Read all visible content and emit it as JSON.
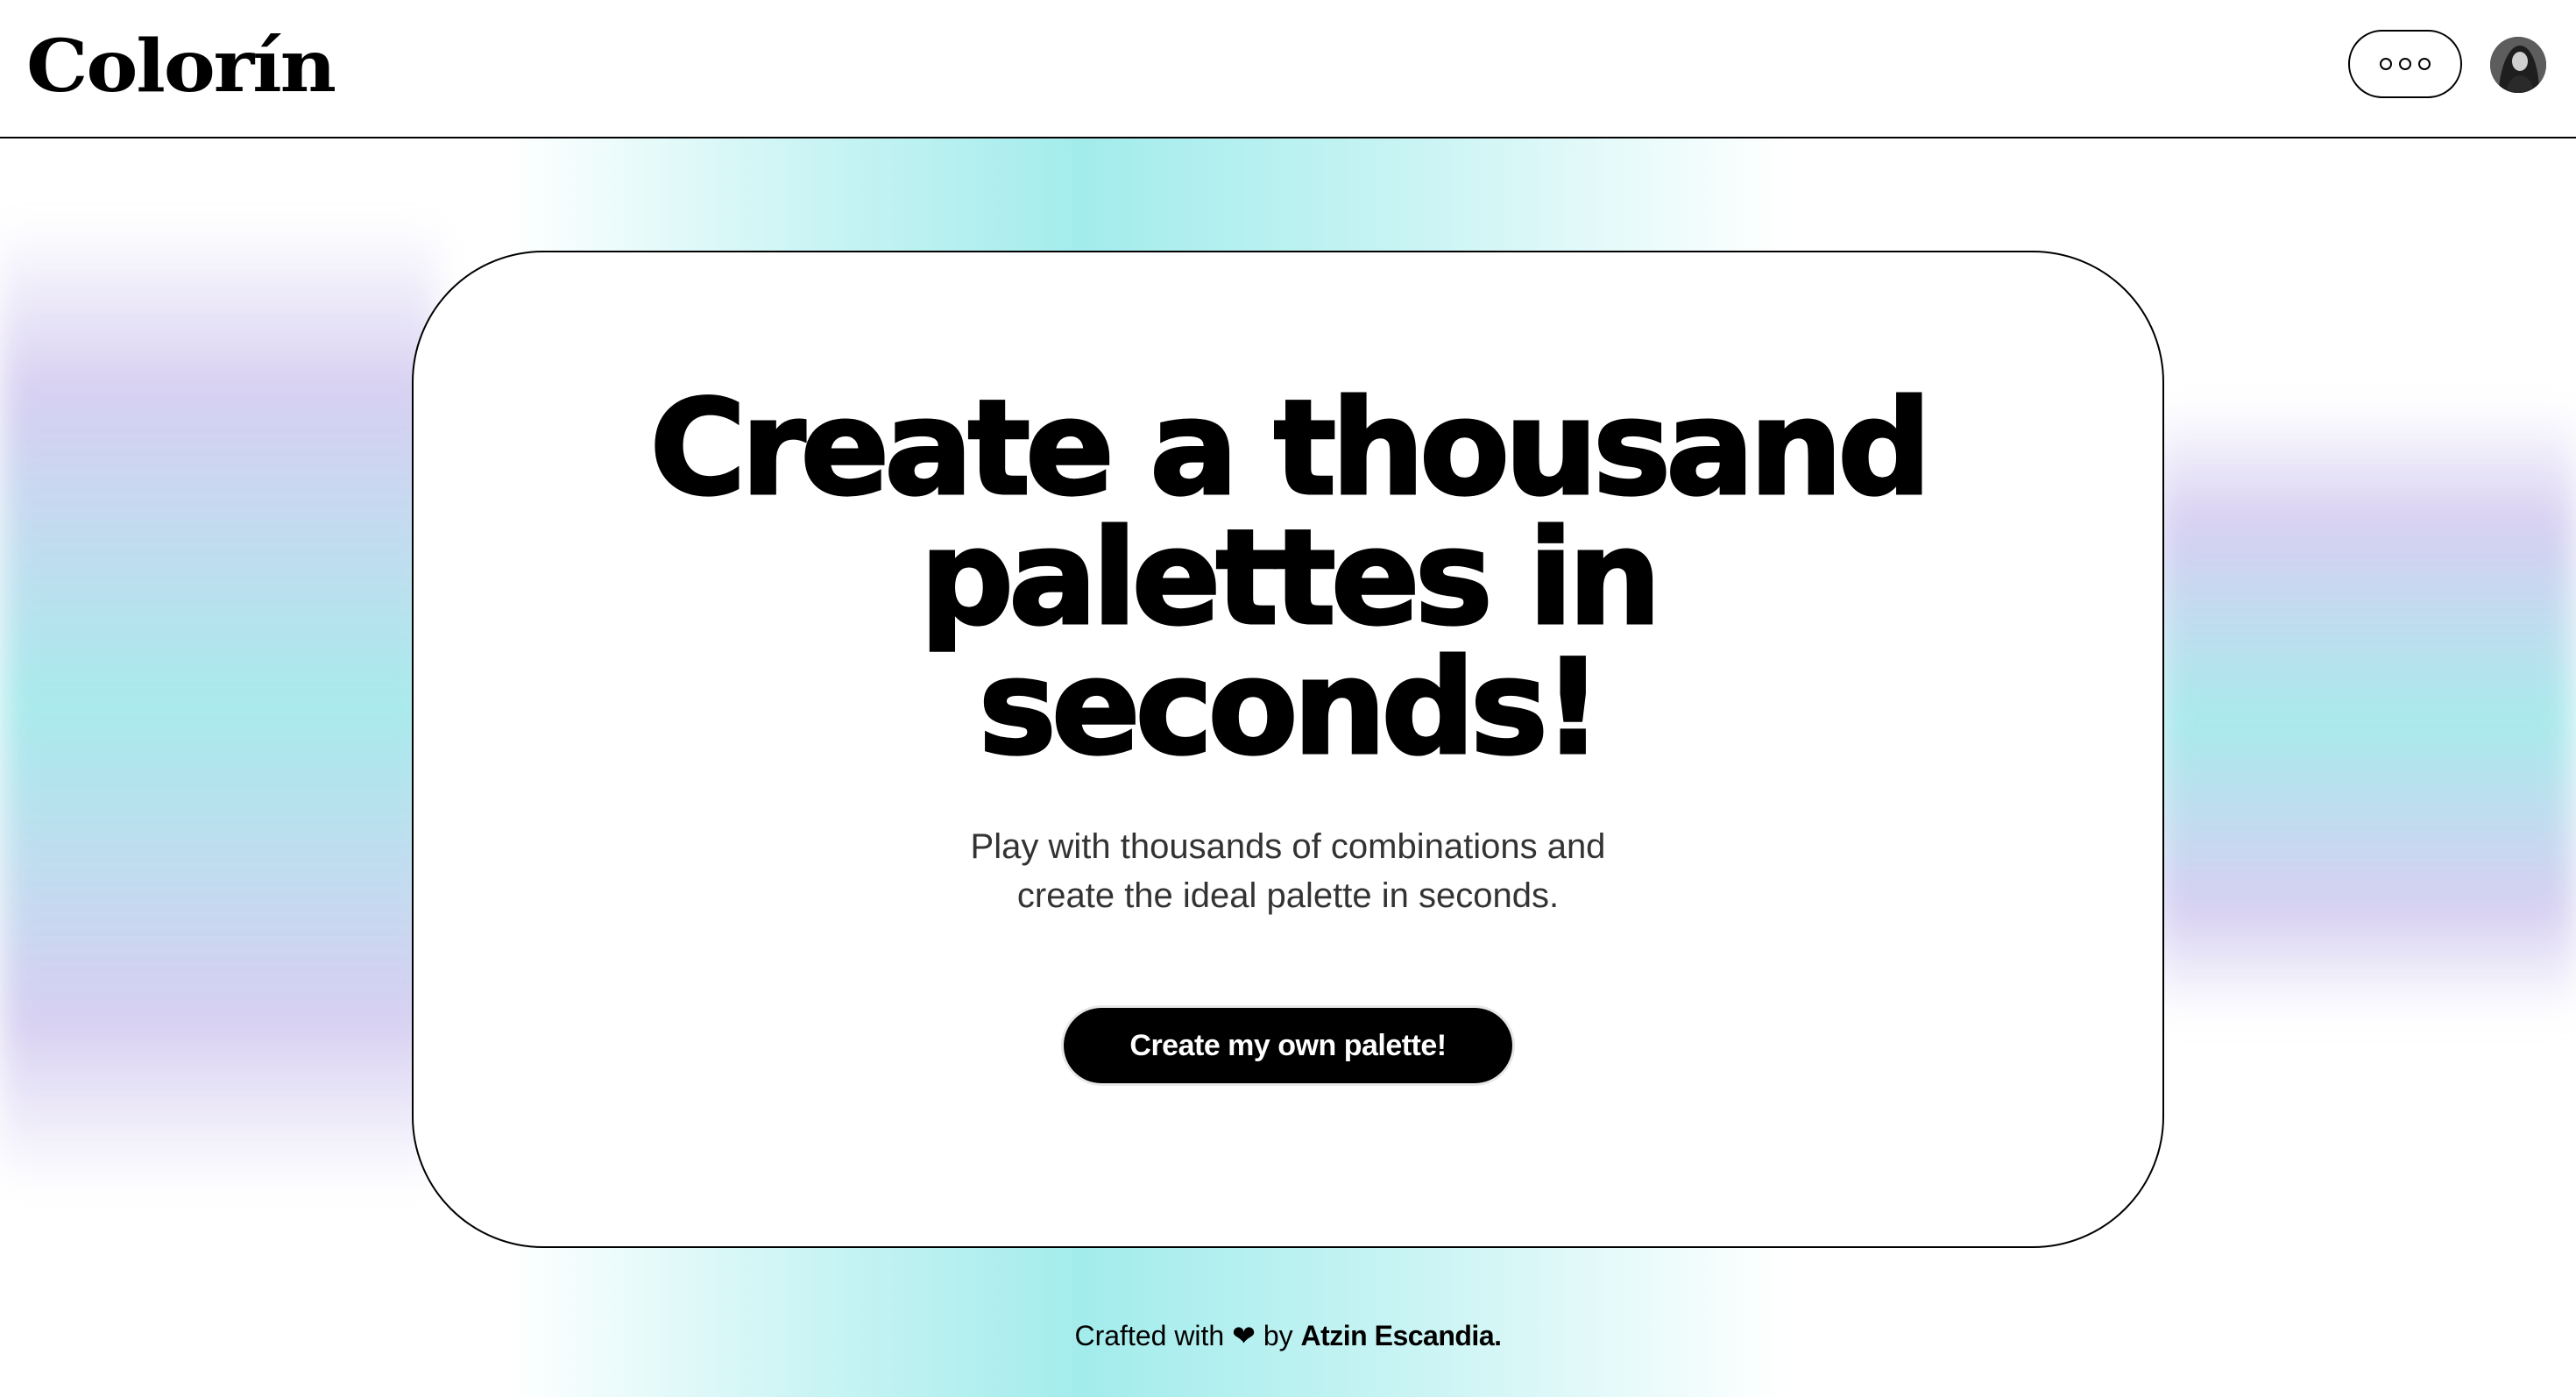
{
  "header": {
    "logo": "Colorín",
    "menu_icon": "more-horizontal-icon",
    "avatar": "user-avatar"
  },
  "hero": {
    "title_lines": [
      "Create a thousand",
      "palettes in",
      "seconds!"
    ],
    "subtitle_lines": [
      "Play with thousands of combinations and",
      "create the ideal palette in seconds."
    ],
    "cta_label": "Create my own palette!"
  },
  "footer": {
    "prefix": "Crafted with",
    "heart": "❤",
    "by": "by",
    "author": "Atzin Escandia."
  },
  "colors": {
    "accent_cyan": "#a3ecec",
    "accent_lavender": "#d2caf0",
    "button_bg": "#000000",
    "button_text": "#ffffff"
  }
}
